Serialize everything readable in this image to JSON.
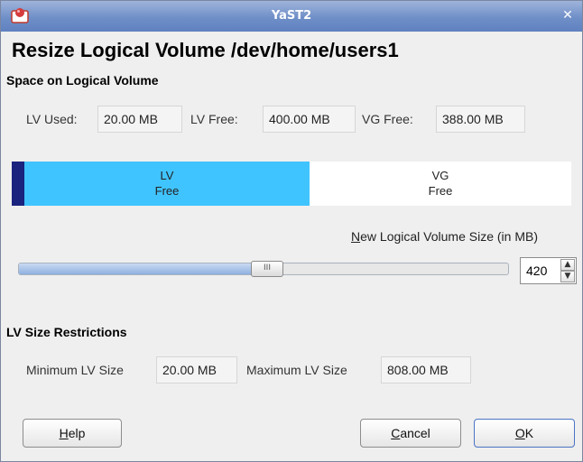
{
  "window": {
    "title": "YaST2",
    "close_icon": "close-icon"
  },
  "heading": "Resize Logical Volume /dev/home/users1",
  "space_section": {
    "title": "Space on Logical Volume",
    "lv_used_label": "LV Used:",
    "lv_used_value": "20.00 MB",
    "lv_free_label": "LV Free:",
    "lv_free_value": "400.00 MB",
    "vg_free_label": "VG Free:",
    "vg_free_value": "388.00 MB"
  },
  "usage_bar": {
    "lv_label_1": "LV",
    "lv_label_2": "Free",
    "vg_label_1": "VG",
    "vg_label_2": "Free",
    "colors": {
      "used": "#1a237e",
      "lv_free": "#40c4ff",
      "vg_free": "#ffffff"
    }
  },
  "size_control": {
    "label_mnemonic": "N",
    "label_rest": "ew Logical Volume Size (in MB)",
    "value": "420",
    "min": 20,
    "max": 808,
    "handle_grip": "III"
  },
  "restrictions": {
    "title": "LV Size Restrictions",
    "min_label": "Minimum LV Size",
    "min_value": "20.00 MB",
    "max_label": "Maximum LV Size",
    "max_value": "808.00 MB"
  },
  "buttons": {
    "help_mnemonic": "H",
    "help_rest": "elp",
    "cancel_mnemonic": "C",
    "cancel_rest": "ancel",
    "ok_mnemonic": "O",
    "ok_rest": "K"
  }
}
